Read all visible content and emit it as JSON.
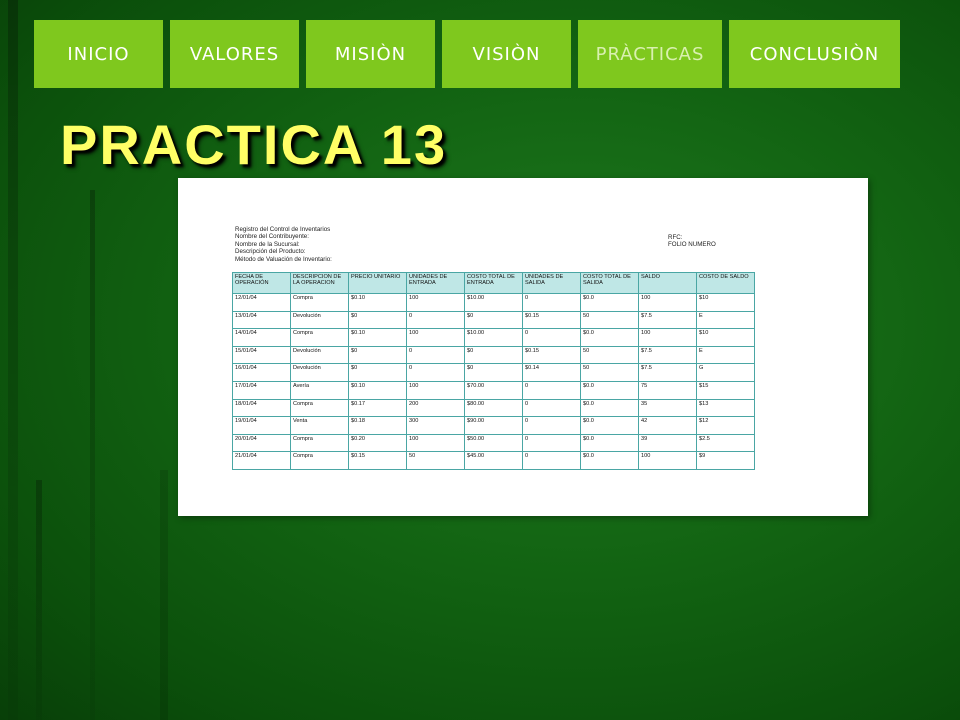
{
  "nav": {
    "tabs": [
      {
        "label": "INICIO",
        "muted": false
      },
      {
        "label": "VALORES",
        "muted": false
      },
      {
        "label": "MISIÒN",
        "muted": false
      },
      {
        "label": "VISIÒN",
        "muted": false
      },
      {
        "label": "PRÀCTICAS",
        "muted": true
      },
      {
        "label": "CONCLUSIÒN",
        "muted": false
      }
    ]
  },
  "colors": {
    "nav_tab": "#7fc81e",
    "title": "#ffff66",
    "table_header": "#bfe7e6",
    "table_border": "#4aa6a4"
  },
  "page_title": "PRACTICA 13",
  "sheet": {
    "meta_left": [
      "Registro del Control de Inventarios",
      "Nombre del Contribuyente:",
      "Nombre de la Sucursal:",
      "Descripción del Producto:",
      "Método de Valuación de Inventario:"
    ],
    "meta_right": [
      "RFC:",
      "FOLIO NUMERO"
    ],
    "columns": [
      "FECHA DE OPERACIÓN",
      "DESCRIPCION DE LA OPERACION",
      "PRECIO UNITARIO",
      "UNIDADES DE ENTRADA",
      "COSTO TOTAL DE ENTRADA",
      "UNIDADES DE SALIDA",
      "COSTO TOTAL DE SALIDA",
      "SALDO",
      "COSTO DE SALDO"
    ],
    "rows": [
      [
        "12/01/04",
        "Compra",
        "$0.10",
        "100",
        "$10.00",
        "0",
        "$0.0",
        "100",
        "$10"
      ],
      [
        "13/01/04",
        "Devolución",
        "$0",
        "0",
        "$0",
        "$0.15",
        "50",
        "$7.5",
        "E"
      ],
      [
        "14/01/04",
        "Compra",
        "$0.10",
        "100",
        "$10.00",
        "0",
        "$0.0",
        "100",
        "$10"
      ],
      [
        "15/01/04",
        "Devolución",
        "$0",
        "0",
        "$0",
        "$0.15",
        "50",
        "$7.5",
        "E"
      ],
      [
        "16/01/04",
        "Devolución",
        "$0",
        "0",
        "$0",
        "$0.14",
        "50",
        "$7.5",
        "G"
      ],
      [
        "17/01/04",
        "Avería",
        "$0.10",
        "100",
        "$70.00",
        "0",
        "$0.0",
        "75",
        "$15"
      ],
      [
        "18/01/04",
        "Compra",
        "$0.17",
        "200",
        "$80.00",
        "0",
        "$0.0",
        "35",
        "$13"
      ],
      [
        "19/01/04",
        "Venta",
        "$0.18",
        "300",
        "$90.00",
        "0",
        "$0.0",
        "42",
        "$12"
      ],
      [
        "20/01/04",
        "Compra",
        "$0.20",
        "100",
        "$50.00",
        "0",
        "$0.0",
        "39",
        "$2.5"
      ],
      [
        "21/01/04",
        "Compra",
        "$0.15",
        "50",
        "$45.00",
        "0",
        "$0.0",
        "100",
        "$9"
      ]
    ]
  }
}
